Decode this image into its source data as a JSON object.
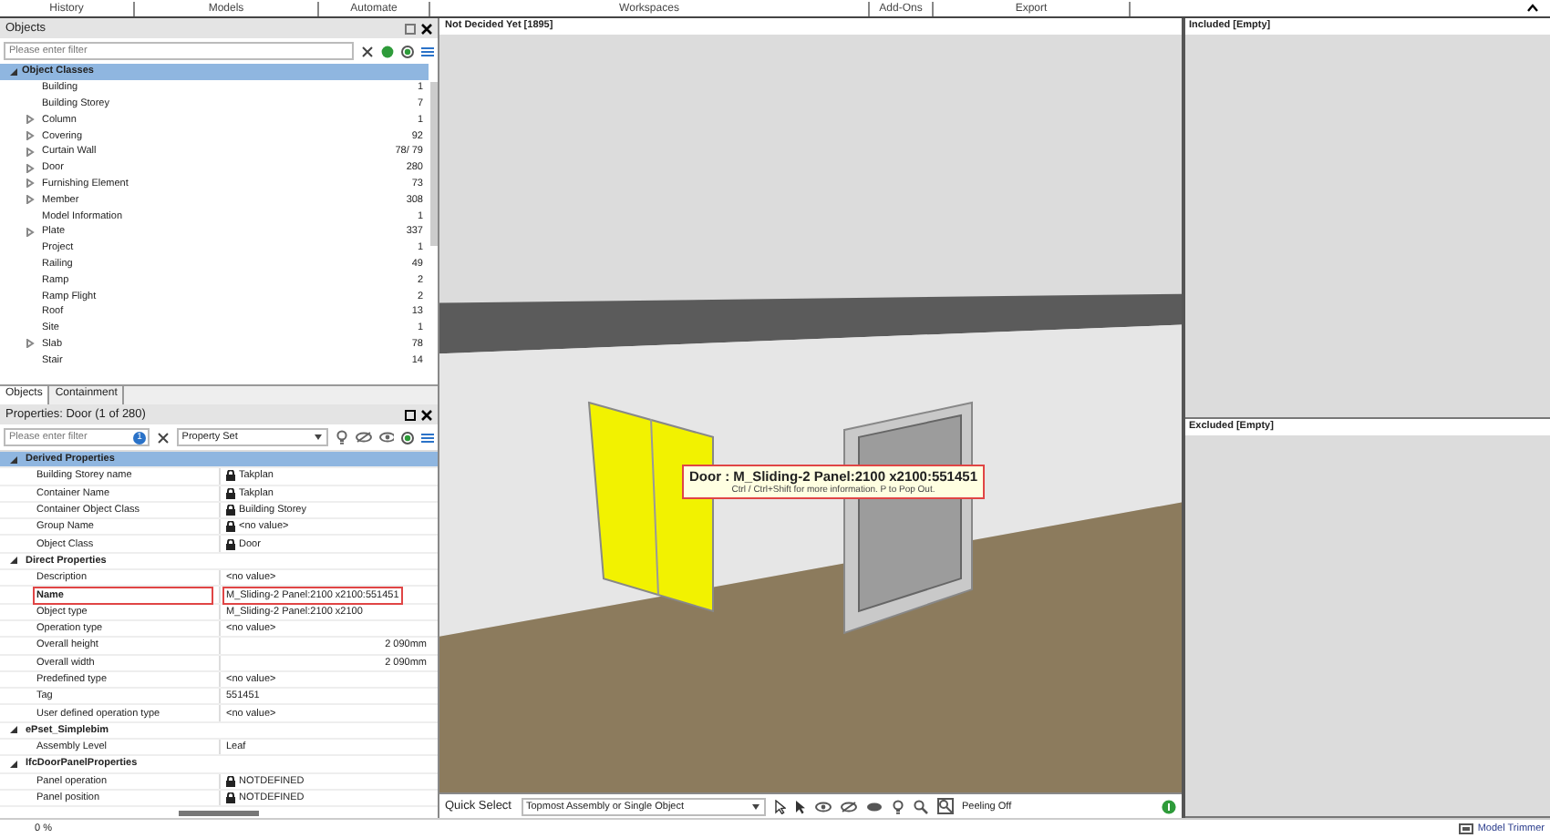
{
  "menu": [
    "History",
    "Models",
    "Automate",
    "Workspaces",
    "Add-Ons",
    "Export"
  ],
  "objects_panel": {
    "title": "Objects",
    "filter_placeholder": "Please enter filter",
    "root": {
      "label": "Object Classes",
      "expanded": true,
      "selected": true,
      "children": [
        {
          "label": "Building",
          "count": "1",
          "has_children": false
        },
        {
          "label": "Building Storey",
          "count": "7",
          "has_children": false
        },
        {
          "label": "Column",
          "count": "1",
          "has_children": true
        },
        {
          "label": "Covering",
          "count": "92",
          "has_children": true
        },
        {
          "label": "Curtain Wall",
          "count": "78/ 79",
          "has_children": true
        },
        {
          "label": "Door",
          "count": "280",
          "has_children": true
        },
        {
          "label": "Furnishing Element",
          "count": "73",
          "has_children": true
        },
        {
          "label": "Member",
          "count": "308",
          "has_children": true
        },
        {
          "label": "Model Information",
          "count": "1",
          "has_children": false
        },
        {
          "label": "Plate",
          "count": "337",
          "has_children": true
        },
        {
          "label": "Project",
          "count": "1",
          "has_children": false
        },
        {
          "label": "Railing",
          "count": "49",
          "has_children": false
        },
        {
          "label": "Ramp",
          "count": "2",
          "has_children": false
        },
        {
          "label": "Ramp Flight",
          "count": "2",
          "has_children": false
        },
        {
          "label": "Roof",
          "count": "13",
          "has_children": false
        },
        {
          "label": "Site",
          "count": "1",
          "has_children": false
        },
        {
          "label": "Slab",
          "count": "78",
          "has_children": true
        },
        {
          "label": "Stair",
          "count": "14",
          "has_children": false
        }
      ]
    },
    "tabs": [
      {
        "label": "Objects",
        "selected": true
      },
      {
        "label": "Containment",
        "selected": false
      }
    ]
  },
  "properties_panel": {
    "title": "Properties: Door (1 of 280)",
    "filter_placeholder": "Please enter filter",
    "filter_badge": "1",
    "property_set": "Property Set",
    "groups": [
      {
        "name": "Derived Properties",
        "expanded": true,
        "selected": true,
        "rows": [
          {
            "name": "Building Storey name",
            "value": "Takplan",
            "locked": true,
            "highlighted": false,
            "kind": "text"
          },
          {
            "name": "Container Name",
            "value": "Takplan",
            "locked": true,
            "highlighted": false,
            "kind": "text"
          },
          {
            "name": "Container Object Class",
            "value": "Building Storey",
            "locked": true,
            "highlighted": false,
            "kind": "text"
          },
          {
            "name": "Group Name",
            "value": "<no value>",
            "locked": true,
            "highlighted": false,
            "kind": "text"
          },
          {
            "name": "Object Class",
            "value": "Door",
            "locked": true,
            "highlighted": false,
            "kind": "text"
          }
        ]
      },
      {
        "name": "Direct Properties",
        "expanded": true,
        "selected": false,
        "rows": [
          {
            "name": "Description",
            "value": "<no value>",
            "locked": false,
            "highlighted": false,
            "kind": "text"
          },
          {
            "name": "Name",
            "value": "M_Sliding-2 Panel:2100 x2100:551451",
            "locked": false,
            "highlighted": true,
            "kind": "text"
          },
          {
            "name": "Object type",
            "value": "M_Sliding-2 Panel:2100 x2100",
            "locked": false,
            "highlighted": false,
            "kind": "text"
          },
          {
            "name": "Operation type",
            "value": "<no value>",
            "locked": false,
            "highlighted": false,
            "kind": "text"
          },
          {
            "name": "Overall height",
            "value": "2 090mm",
            "locked": false,
            "highlighted": false,
            "kind": "number"
          },
          {
            "name": "Overall width",
            "value": "2 090mm",
            "locked": false,
            "highlighted": false,
            "kind": "number"
          },
          {
            "name": "Predefined type",
            "value": "<no value>",
            "locked": false,
            "highlighted": false,
            "kind": "text"
          },
          {
            "name": "Tag",
            "value": "551451",
            "locked": false,
            "highlighted": false,
            "kind": "text"
          },
          {
            "name": "User defined operation type",
            "value": "<no value>",
            "locked": false,
            "highlighted": false,
            "kind": "text"
          }
        ]
      },
      {
        "name": "ePset_Simplebim",
        "expanded": true,
        "selected": false,
        "rows": [
          {
            "name": "Assembly Level",
            "value": "Leaf",
            "locked": false,
            "highlighted": false,
            "kind": "text"
          }
        ]
      },
      {
        "name": "IfcDoorPanelProperties",
        "expanded": true,
        "selected": false,
        "rows": [
          {
            "name": "Panel operation",
            "value": "NOTDEFINED",
            "locked": true,
            "highlighted": false,
            "kind": "text"
          },
          {
            "name": "Panel position",
            "value": "NOTDEFINED",
            "locked": true,
            "highlighted": false,
            "kind": "text"
          }
        ]
      }
    ]
  },
  "viewport": {
    "title": "Not Decided Yet [1895]",
    "tooltip": {
      "title": "Door : M_Sliding-2 Panel:2100 x2100:551451",
      "hint": "Ctrl / Ctrl+Shift for more information. P to Pop Out."
    }
  },
  "included_panel": {
    "title": "Included [Empty]"
  },
  "excluded_panel": {
    "title": "Excluded [Empty]"
  },
  "toolbar": {
    "label": "Quick Select",
    "mode": "Topmost Assembly or Single Object",
    "peeling": "Peeling Off"
  },
  "status_bar": {
    "progress": "0 %",
    "tool": "Model Trimmer"
  }
}
